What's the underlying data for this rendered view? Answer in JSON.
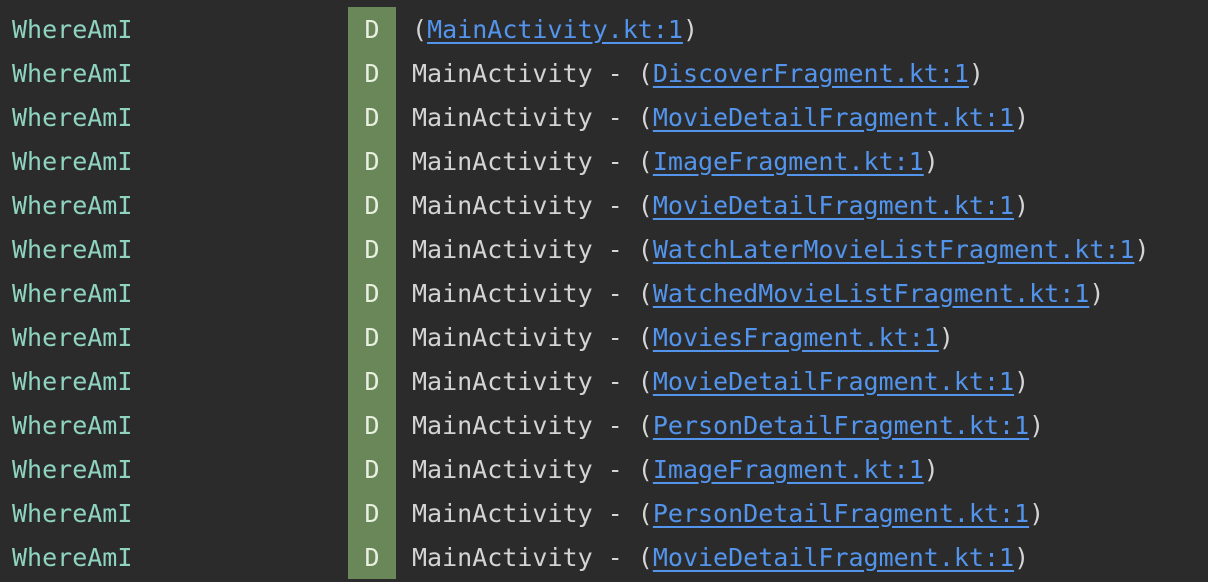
{
  "colors": {
    "background": "#2b2b2c",
    "tag": "#8fd4bf",
    "level_bg": "#6a8759",
    "link": "#5394ec",
    "text": "#d4d4d4"
  },
  "rows": [
    {
      "tag": "WhereAmI",
      "level": "D",
      "prefix": "",
      "open": "(",
      "link": "MainActivity.kt:1",
      "close": ")"
    },
    {
      "tag": "WhereAmI",
      "level": "D",
      "prefix": "MainActivity - ",
      "open": "(",
      "link": "DiscoverFragment.kt:1",
      "close": ")"
    },
    {
      "tag": "WhereAmI",
      "level": "D",
      "prefix": "MainActivity - ",
      "open": "(",
      "link": "MovieDetailFragment.kt:1",
      "close": ")"
    },
    {
      "tag": "WhereAmI",
      "level": "D",
      "prefix": "MainActivity - ",
      "open": "(",
      "link": "ImageFragment.kt:1",
      "close": ")"
    },
    {
      "tag": "WhereAmI",
      "level": "D",
      "prefix": "MainActivity - ",
      "open": "(",
      "link": "MovieDetailFragment.kt:1",
      "close": ")"
    },
    {
      "tag": "WhereAmI",
      "level": "D",
      "prefix": "MainActivity - ",
      "open": "(",
      "link": "WatchLaterMovieListFragment.kt:1",
      "close": ")"
    },
    {
      "tag": "WhereAmI",
      "level": "D",
      "prefix": "MainActivity - ",
      "open": "(",
      "link": "WatchedMovieListFragment.kt:1",
      "close": ")"
    },
    {
      "tag": "WhereAmI",
      "level": "D",
      "prefix": "MainActivity - ",
      "open": "(",
      "link": "MoviesFragment.kt:1",
      "close": ")"
    },
    {
      "tag": "WhereAmI",
      "level": "D",
      "prefix": "MainActivity - ",
      "open": "(",
      "link": "MovieDetailFragment.kt:1",
      "close": ")"
    },
    {
      "tag": "WhereAmI",
      "level": "D",
      "prefix": "MainActivity - ",
      "open": "(",
      "link": "PersonDetailFragment.kt:1",
      "close": ")"
    },
    {
      "tag": "WhereAmI",
      "level": "D",
      "prefix": "MainActivity - ",
      "open": "(",
      "link": "ImageFragment.kt:1",
      "close": ")"
    },
    {
      "tag": "WhereAmI",
      "level": "D",
      "prefix": "MainActivity - ",
      "open": "(",
      "link": "PersonDetailFragment.kt:1",
      "close": ")"
    },
    {
      "tag": "WhereAmI",
      "level": "D",
      "prefix": "MainActivity - ",
      "open": "(",
      "link": "MovieDetailFragment.kt:1",
      "close": ")"
    }
  ]
}
